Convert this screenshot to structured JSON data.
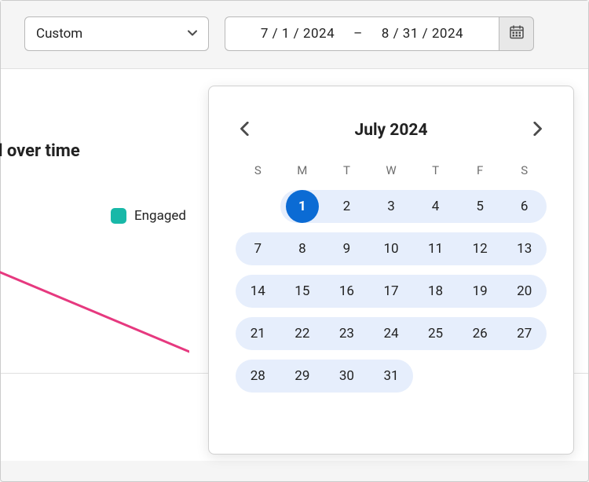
{
  "topbar": {
    "select_label": "Custom",
    "date_start": "7 /   1 / 2024",
    "date_sep": "–",
    "date_end": "8 / 31 / 2024"
  },
  "section": {
    "title_fragment": "d over time"
  },
  "legend": {
    "series1": "Engaged",
    "color1": "#18b8a8"
  },
  "chart_data": {
    "type": "line",
    "series": [
      {
        "name": "Engaged",
        "color": "#e6397f",
        "points_visible_segment": [
          [
            0,
            0.35
          ],
          [
            1,
            0.78
          ]
        ]
      }
    ],
    "note": "only a diagonal segment of a pink line is visible in the cropped viewport"
  },
  "calendar": {
    "month_label": "July 2024",
    "weekdays": [
      "S",
      "M",
      "T",
      "W",
      "T",
      "F",
      "S"
    ],
    "first_weekday_index": 1,
    "days_in_month": 31,
    "selected_start": 1,
    "range_end_in_view": 31
  }
}
